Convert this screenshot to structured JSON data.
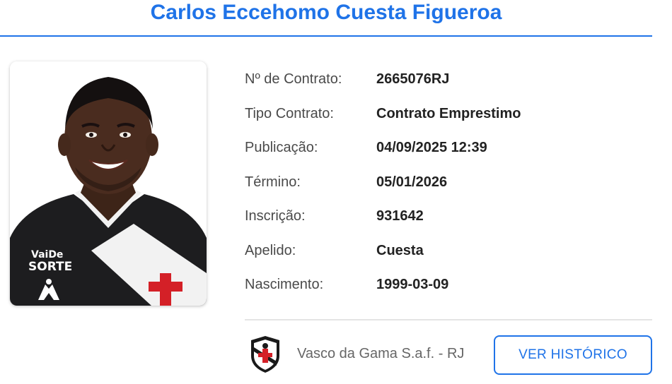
{
  "player": {
    "name": "Carlos Eccehomo Cuesta Figueroa"
  },
  "fields": [
    {
      "label": "Nº de Contrato:",
      "value": "2665076RJ"
    },
    {
      "label": "Tipo Contrato:",
      "value": "Contrato Emprestimo"
    },
    {
      "label": "Publicação:",
      "value": "04/09/2025 12:39"
    },
    {
      "label": "Término:",
      "value": "05/01/2026"
    },
    {
      "label": "Inscrição:",
      "value": "931642"
    },
    {
      "label": "Apelido:",
      "value": "Cuesta"
    },
    {
      "label": "Nascimento:",
      "value": "1999-03-09"
    }
  ],
  "club": {
    "name": "Vasco da Gama S.a.f. - RJ",
    "icon": "club-crest-icon"
  },
  "actions": {
    "history_label": "VER HISTÓRICO"
  },
  "jersey_text": {
    "sponsor_top": "VaiDe",
    "sponsor_bottom": "SORTE"
  },
  "colors": {
    "accent": "#1f73e8",
    "cross_red": "#d42027"
  }
}
